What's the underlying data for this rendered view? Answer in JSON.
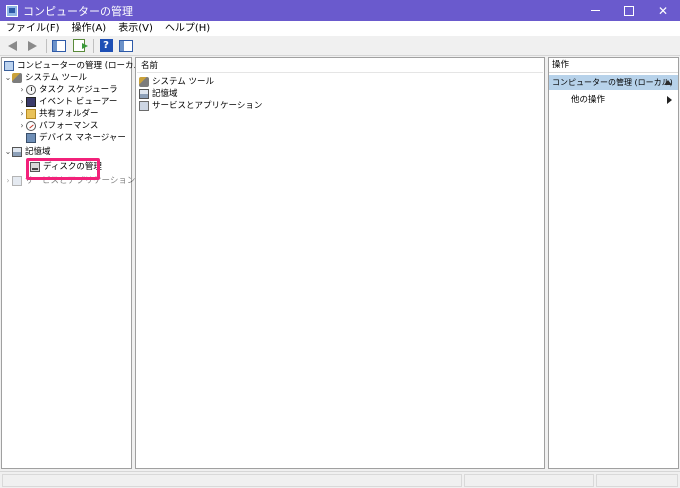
{
  "window": {
    "title": "コンピューターの管理"
  },
  "menubar": {
    "items": [
      "ファイル(F)",
      "操作(A)",
      "表示(V)",
      "ヘルプ(H)"
    ]
  },
  "tree": {
    "root": "コンピューターの管理 (ローカル)",
    "system_tools": "システム ツール",
    "task_scheduler": "タスク スケジューラ",
    "event_viewer": "イベント ビューアー",
    "shared_folders": "共有フォルダー",
    "performance": "パフォーマンス",
    "device_manager": "デバイス マネージャー",
    "storage": "記憶域",
    "disk_management": "ディスクの管理",
    "services_apps": "サービスとアプリケーション"
  },
  "center": {
    "column_name": "名前",
    "items": [
      "システム ツール",
      "記憶域",
      "サービスとアプリケーション"
    ]
  },
  "actions": {
    "title": "操作",
    "section": "コンピューターの管理 (ローカル)",
    "more": "他の操作"
  },
  "colors": {
    "titlebar": "#6a5acd",
    "highlight": "#f2217a",
    "actions_section": "#b7d2ea"
  }
}
